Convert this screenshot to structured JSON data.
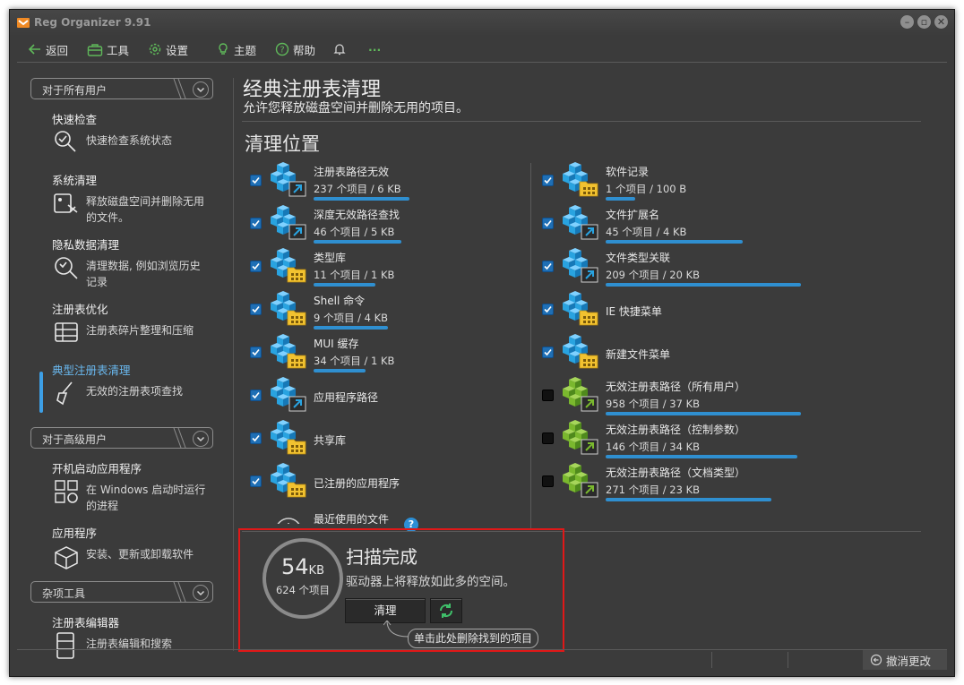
{
  "window": {
    "title": "Reg Organizer 9.91"
  },
  "toolbar": {
    "back": "返回",
    "tools": "工具",
    "settings": "设置",
    "theme": "主题",
    "help": "帮助",
    "more": "···"
  },
  "sidebar": {
    "group_all_users": "对于所有用户",
    "group_advanced": "对于高级用户",
    "group_misc": "杂项工具",
    "items": [
      {
        "title": "快速检查",
        "desc": "快速检查系统状态",
        "icon": "stethoscope-icon"
      },
      {
        "title": "系统清理",
        "desc": "释放磁盘空间并删除无用的文件。",
        "icon": "disk-cleanup-icon"
      },
      {
        "title": "隐私数据清理",
        "desc": "清理数据, 例如浏览历史记录",
        "icon": "privacy-clean-icon"
      },
      {
        "title": "注册表优化",
        "desc": "注册表碎片整理和压缩",
        "icon": "registry-optimize-icon"
      },
      {
        "title": "典型注册表清理",
        "desc": "无效的注册表项查找",
        "icon": "broom-icon"
      },
      {
        "title": "开机启动应用程序",
        "desc": "在 Windows 启动时运行的进程",
        "icon": "startup-icon"
      },
      {
        "title": "应用程序",
        "desc": "安装、更新或卸载软件",
        "icon": "box-icon"
      },
      {
        "title": "注册表编辑器",
        "desc": "注册表编辑和搜索",
        "icon": "registry-editor-icon"
      }
    ]
  },
  "main": {
    "title": "经典注册表清理",
    "subtitle": "允许您释放磁盘空间并删除无用的项目。",
    "section_title": "清理位置"
  },
  "left_items": [
    {
      "name": "注册表路径无效",
      "stat": "237 个项目 / 6 KB",
      "checked": true,
      "badge": "shortcut",
      "fill": 0.85
    },
    {
      "name": "深度无效路径查找",
      "stat": "46 个项目 / 5 KB",
      "checked": true,
      "badge": "shortcut",
      "fill": 0.78
    },
    {
      "name": "类型库",
      "stat": "11 个项目 / 1 KB",
      "checked": true,
      "badge": "folder",
      "fill": 0.55
    },
    {
      "name": "Shell 命令",
      "stat": "9 个项目 / 4 KB",
      "checked": true,
      "badge": "folder",
      "fill": 0.66
    },
    {
      "name": "MUI 缓存",
      "stat": "34 个项目 / 1 KB",
      "checked": true,
      "badge": "folder",
      "fill": 0.46
    },
    {
      "name": "应用程序路径",
      "stat": "",
      "checked": true,
      "badge": "shortcut",
      "fill": 0
    },
    {
      "name": "共享库",
      "stat": "",
      "checked": true,
      "badge": "folder",
      "fill": 0
    },
    {
      "name": "已注册的应用程序",
      "stat": "",
      "checked": true,
      "badge": "folder",
      "fill": 0
    },
    {
      "name": "最近使用的文件",
      "stat": "",
      "checked": true,
      "badge": "clock",
      "fill": 0
    }
  ],
  "right_items": [
    {
      "name": "软件记录",
      "stat": "1 个项目 / 100 B",
      "checked": true,
      "badge": "folder",
      "fill": 0.15
    },
    {
      "name": "文件扩展名",
      "stat": "45 个项目 / 4 KB",
      "checked": true,
      "badge": "shortcut",
      "fill": 0.7
    },
    {
      "name": "文件类型关联",
      "stat": "209 个项目 / 20 KB",
      "checked": true,
      "badge": "shortcut",
      "fill": 1.0
    },
    {
      "name": "IE 快捷菜单",
      "stat": "",
      "checked": true,
      "badge": "folder",
      "fill": 0
    },
    {
      "name": "新建文件菜单",
      "stat": "",
      "checked": true,
      "badge": "folder",
      "fill": 0
    },
    {
      "name": "无效注册表路径（所有用户）",
      "stat": "958 个项目 / 37 KB",
      "checked": false,
      "badge": "shortcut-green",
      "fill": 1.0
    },
    {
      "name": "无效注册表路径（控制参数）",
      "stat": "146 个项目 / 34 KB",
      "checked": false,
      "badge": "shortcut-green",
      "fill": 0.98
    },
    {
      "name": "无效注册表路径（文档类型）",
      "stat": "271 个项目 / 23 KB",
      "checked": false,
      "badge": "shortcut-green",
      "fill": 0.85
    }
  ],
  "result": {
    "size": "54",
    "size_unit": "KB",
    "count": "624 个项目",
    "title": "扫描完成",
    "subtitle": "驱动器上将释放如此多的空间。",
    "clean_button": "清理",
    "tooltip": "单击此处删除找到的项目"
  },
  "status": {
    "undo": "撤消更改"
  },
  "colors": {
    "accent_blue": "#2f8fd0",
    "highlight_red": "#e01818",
    "cube_blue": "#29a3e0",
    "cube_green": "#7ab82e",
    "folder_yellow": "#f2c230"
  }
}
